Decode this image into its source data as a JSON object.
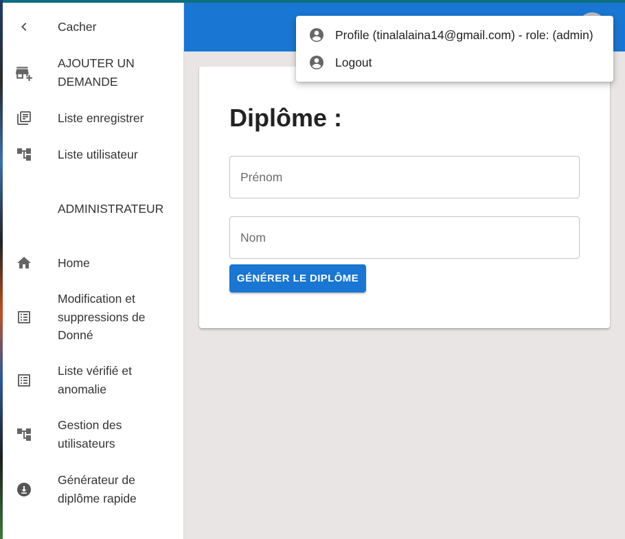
{
  "sidebar": {
    "items": [
      {
        "label": "Cacher",
        "icon": "chevron-left-icon"
      },
      {
        "label": "AJOUTER UN DEMANDE",
        "icon": "add-business-icon"
      },
      {
        "label": "Liste enregistrer",
        "icon": "library-books-icon"
      },
      {
        "label": "Liste utilisateur",
        "icon": "account-tree-icon"
      },
      {
        "label": "ADMINISTRATEUR",
        "icon": ""
      },
      {
        "label": "Home",
        "icon": "home-icon"
      },
      {
        "label": "Modification et suppressions de Donné",
        "icon": "list-alt-icon"
      },
      {
        "label": "Liste vérifié et anomalie",
        "icon": "list-alt-icon"
      },
      {
        "label": "Gestion des utilisateurs",
        "icon": "account-tree-icon"
      },
      {
        "label": "Générateur de diplôme rapide",
        "icon": "download-circle-icon"
      }
    ]
  },
  "header": {
    "color": "#1976d2"
  },
  "form": {
    "title": "Diplôme :",
    "firstname_placeholder": "Prénom",
    "lastname_placeholder": "Nom",
    "generate_label": "GÉNÉRER LE DIPLÔME"
  },
  "account_menu": {
    "profile_label": "Profile (tinalalaina14@gmail.com) - role: (admin)",
    "logout_label": "Logout"
  }
}
